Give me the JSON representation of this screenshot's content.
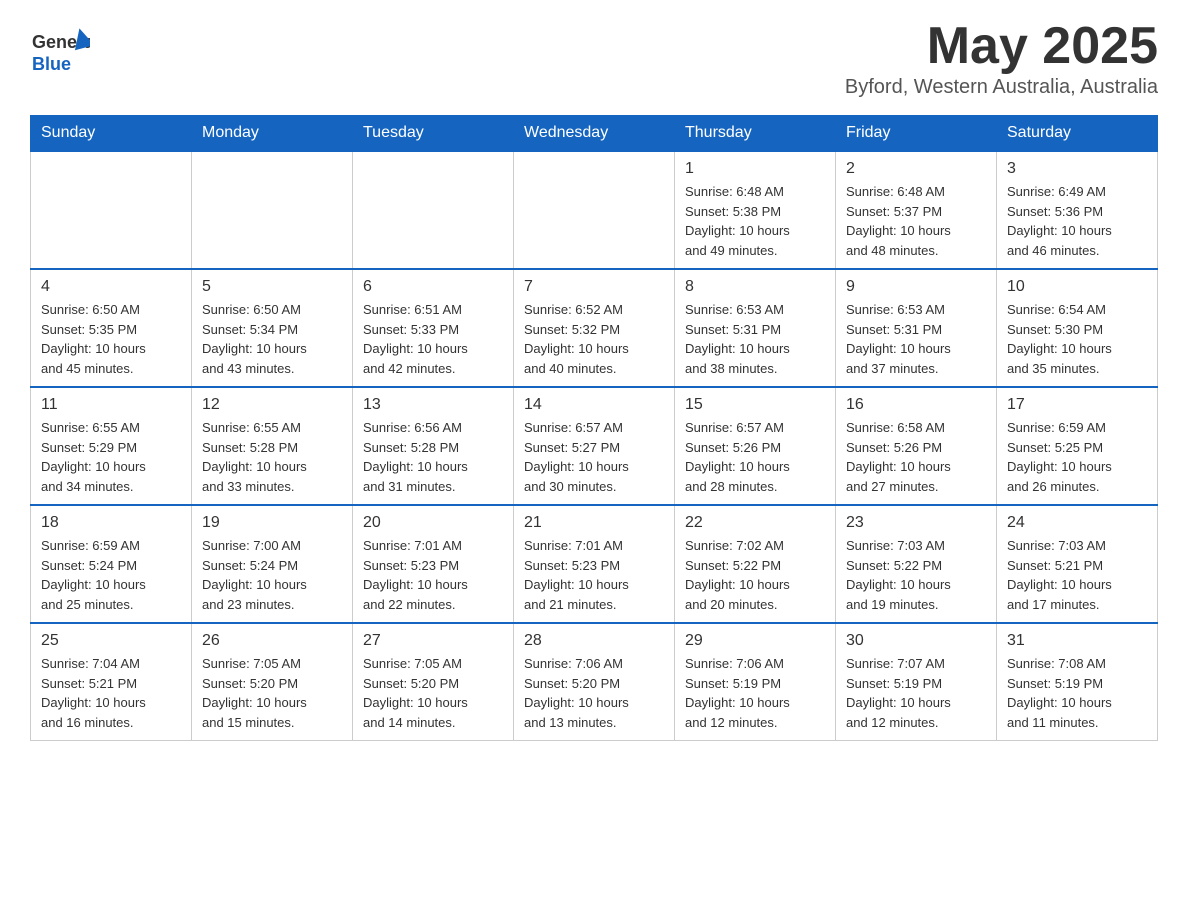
{
  "header": {
    "logo_general": "General",
    "logo_blue": "Blue",
    "title": "May 2025",
    "subtitle": "Byford, Western Australia, Australia"
  },
  "days_of_week": [
    "Sunday",
    "Monday",
    "Tuesday",
    "Wednesday",
    "Thursday",
    "Friday",
    "Saturday"
  ],
  "weeks": [
    {
      "days": [
        {
          "num": "",
          "info": ""
        },
        {
          "num": "",
          "info": ""
        },
        {
          "num": "",
          "info": ""
        },
        {
          "num": "",
          "info": ""
        },
        {
          "num": "1",
          "info": "Sunrise: 6:48 AM\nSunset: 5:38 PM\nDaylight: 10 hours\nand 49 minutes."
        },
        {
          "num": "2",
          "info": "Sunrise: 6:48 AM\nSunset: 5:37 PM\nDaylight: 10 hours\nand 48 minutes."
        },
        {
          "num": "3",
          "info": "Sunrise: 6:49 AM\nSunset: 5:36 PM\nDaylight: 10 hours\nand 46 minutes."
        }
      ]
    },
    {
      "days": [
        {
          "num": "4",
          "info": "Sunrise: 6:50 AM\nSunset: 5:35 PM\nDaylight: 10 hours\nand 45 minutes."
        },
        {
          "num": "5",
          "info": "Sunrise: 6:50 AM\nSunset: 5:34 PM\nDaylight: 10 hours\nand 43 minutes."
        },
        {
          "num": "6",
          "info": "Sunrise: 6:51 AM\nSunset: 5:33 PM\nDaylight: 10 hours\nand 42 minutes."
        },
        {
          "num": "7",
          "info": "Sunrise: 6:52 AM\nSunset: 5:32 PM\nDaylight: 10 hours\nand 40 minutes."
        },
        {
          "num": "8",
          "info": "Sunrise: 6:53 AM\nSunset: 5:31 PM\nDaylight: 10 hours\nand 38 minutes."
        },
        {
          "num": "9",
          "info": "Sunrise: 6:53 AM\nSunset: 5:31 PM\nDaylight: 10 hours\nand 37 minutes."
        },
        {
          "num": "10",
          "info": "Sunrise: 6:54 AM\nSunset: 5:30 PM\nDaylight: 10 hours\nand 35 minutes."
        }
      ]
    },
    {
      "days": [
        {
          "num": "11",
          "info": "Sunrise: 6:55 AM\nSunset: 5:29 PM\nDaylight: 10 hours\nand 34 minutes."
        },
        {
          "num": "12",
          "info": "Sunrise: 6:55 AM\nSunset: 5:28 PM\nDaylight: 10 hours\nand 33 minutes."
        },
        {
          "num": "13",
          "info": "Sunrise: 6:56 AM\nSunset: 5:28 PM\nDaylight: 10 hours\nand 31 minutes."
        },
        {
          "num": "14",
          "info": "Sunrise: 6:57 AM\nSunset: 5:27 PM\nDaylight: 10 hours\nand 30 minutes."
        },
        {
          "num": "15",
          "info": "Sunrise: 6:57 AM\nSunset: 5:26 PM\nDaylight: 10 hours\nand 28 minutes."
        },
        {
          "num": "16",
          "info": "Sunrise: 6:58 AM\nSunset: 5:26 PM\nDaylight: 10 hours\nand 27 minutes."
        },
        {
          "num": "17",
          "info": "Sunrise: 6:59 AM\nSunset: 5:25 PM\nDaylight: 10 hours\nand 26 minutes."
        }
      ]
    },
    {
      "days": [
        {
          "num": "18",
          "info": "Sunrise: 6:59 AM\nSunset: 5:24 PM\nDaylight: 10 hours\nand 25 minutes."
        },
        {
          "num": "19",
          "info": "Sunrise: 7:00 AM\nSunset: 5:24 PM\nDaylight: 10 hours\nand 23 minutes."
        },
        {
          "num": "20",
          "info": "Sunrise: 7:01 AM\nSunset: 5:23 PM\nDaylight: 10 hours\nand 22 minutes."
        },
        {
          "num": "21",
          "info": "Sunrise: 7:01 AM\nSunset: 5:23 PM\nDaylight: 10 hours\nand 21 minutes."
        },
        {
          "num": "22",
          "info": "Sunrise: 7:02 AM\nSunset: 5:22 PM\nDaylight: 10 hours\nand 20 minutes."
        },
        {
          "num": "23",
          "info": "Sunrise: 7:03 AM\nSunset: 5:22 PM\nDaylight: 10 hours\nand 19 minutes."
        },
        {
          "num": "24",
          "info": "Sunrise: 7:03 AM\nSunset: 5:21 PM\nDaylight: 10 hours\nand 17 minutes."
        }
      ]
    },
    {
      "days": [
        {
          "num": "25",
          "info": "Sunrise: 7:04 AM\nSunset: 5:21 PM\nDaylight: 10 hours\nand 16 minutes."
        },
        {
          "num": "26",
          "info": "Sunrise: 7:05 AM\nSunset: 5:20 PM\nDaylight: 10 hours\nand 15 minutes."
        },
        {
          "num": "27",
          "info": "Sunrise: 7:05 AM\nSunset: 5:20 PM\nDaylight: 10 hours\nand 14 minutes."
        },
        {
          "num": "28",
          "info": "Sunrise: 7:06 AM\nSunset: 5:20 PM\nDaylight: 10 hours\nand 13 minutes."
        },
        {
          "num": "29",
          "info": "Sunrise: 7:06 AM\nSunset: 5:19 PM\nDaylight: 10 hours\nand 12 minutes."
        },
        {
          "num": "30",
          "info": "Sunrise: 7:07 AM\nSunset: 5:19 PM\nDaylight: 10 hours\nand 12 minutes."
        },
        {
          "num": "31",
          "info": "Sunrise: 7:08 AM\nSunset: 5:19 PM\nDaylight: 10 hours\nand 11 minutes."
        }
      ]
    }
  ]
}
